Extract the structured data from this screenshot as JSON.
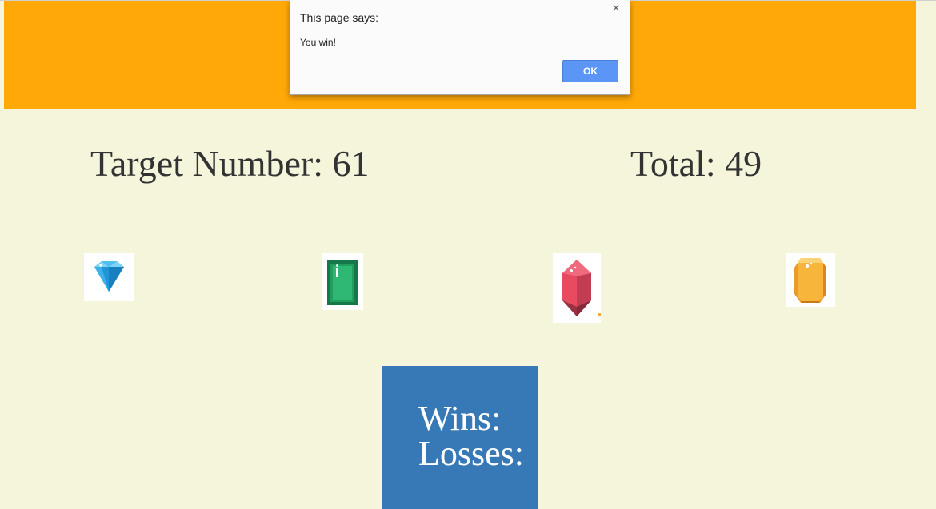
{
  "game": {
    "target_label": "Target Number:",
    "target_value": "61",
    "total_label": "Total:",
    "total_value": "49"
  },
  "gems": [
    {
      "name": "diamond-crystal-icon",
      "color": "#29a7e0"
    },
    {
      "name": "emerald-crystal-icon",
      "color": "#1f9e5e"
    },
    {
      "name": "ruby-crystal-icon",
      "color": "#e84a5f"
    },
    {
      "name": "topaz-crystal-icon",
      "color": "#f7b53c"
    }
  ],
  "score": {
    "wins_label": "Wins:",
    "wins_value": "",
    "losses_label": "Losses:",
    "losses_value": ""
  },
  "dialog": {
    "title": "This page says:",
    "message": "You win!",
    "ok_label": "OK",
    "close_icon": "×"
  },
  "colors": {
    "header": "#ffa807",
    "background": "#f5f5dc",
    "score_box": "#3779b6",
    "ok_button": "#5b96f7"
  }
}
